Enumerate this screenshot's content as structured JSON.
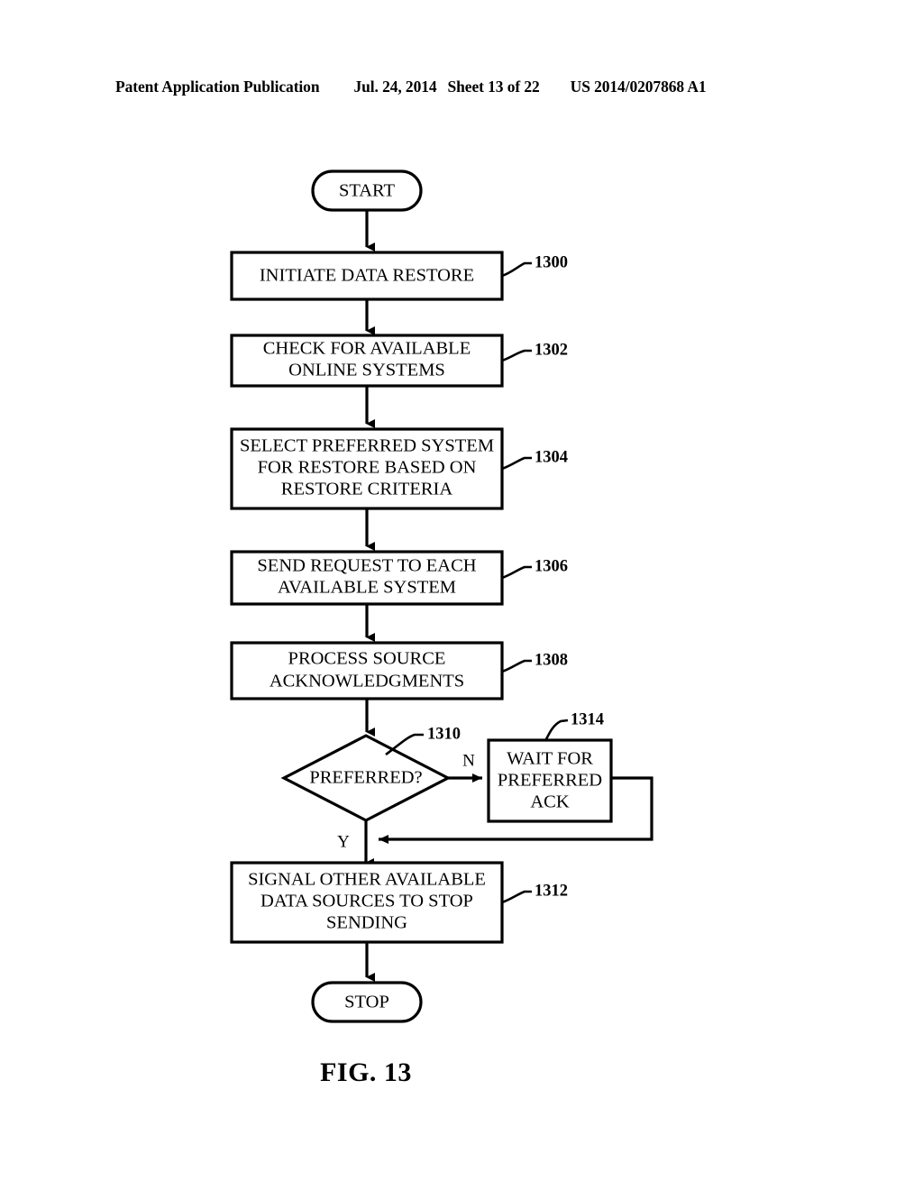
{
  "header": {
    "publication": "Patent Application Publication",
    "date": "Jul. 24, 2014",
    "sheet": "Sheet 13 of 22",
    "patent_number": "US 2014/0207868 A1"
  },
  "figure": {
    "caption": "FIG. 13",
    "nodes": {
      "start": {
        "label": "START"
      },
      "n1300": {
        "label_line1": "INITIATE DATA RESTORE",
        "ref": "1300"
      },
      "n1302": {
        "label_line1": "CHECK FOR AVAILABLE",
        "label_line2": "ONLINE SYSTEMS",
        "ref": "1302"
      },
      "n1304": {
        "label_line1": "SELECT PREFERRED SYSTEM",
        "label_line2": "FOR RESTORE BASED ON",
        "label_line3": "RESTORE CRITERIA",
        "ref": "1304"
      },
      "n1306": {
        "label_line1": "SEND REQUEST TO EACH",
        "label_line2": "AVAILABLE SYSTEM",
        "ref": "1306"
      },
      "n1308": {
        "label_line1": "PROCESS SOURCE",
        "label_line2": "ACKNOWLEDGMENTS",
        "ref": "1308"
      },
      "n1310": {
        "label_line1": "PREFERRED?",
        "ref": "1310"
      },
      "n1314": {
        "label_line1": "WAIT FOR",
        "label_line2": "PREFERRED",
        "label_line3": "ACK",
        "ref": "1314"
      },
      "n1312": {
        "label_line1": "SIGNAL OTHER AVAILABLE",
        "label_line2": "DATA SOURCES TO STOP",
        "label_line3": "SENDING",
        "ref": "1312"
      },
      "stop": {
        "label": "STOP"
      }
    },
    "branches": {
      "no": "N",
      "yes": "Y"
    },
    "colors": {
      "ink": "#000000",
      "paper": "#ffffff"
    }
  }
}
